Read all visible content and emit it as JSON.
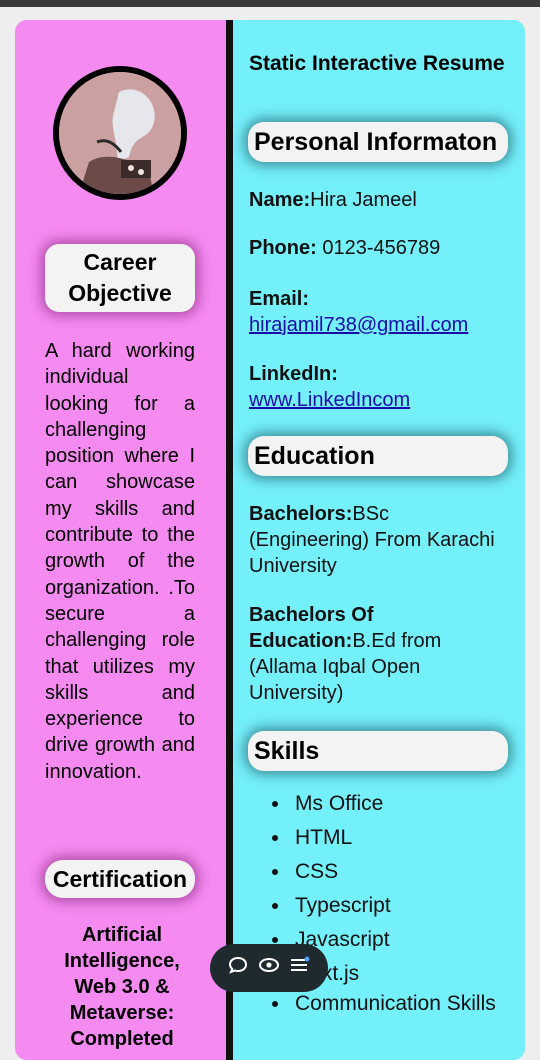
{
  "left": {
    "career_title": "Career Objective",
    "objective": "A hard working individual looking for a challenging position where I can showcase my skills and contribute to the growth of the organization. .To secure a challenging role that utilizes my skills and experience to drive growth and innovation.",
    "cert_title": "Certification",
    "cert_text": "Artificial Intelligence, Web 3.0 & Metaverse: Completed"
  },
  "right": {
    "title": "Static Interactive Resume",
    "personal_header": "Personal Informaton",
    "name_label": "Name:",
    "name_value": "Hira Jameel",
    "phone_label": "Phone:",
    "phone_value": " 0123-456789",
    "email_label": "Email:",
    "email_value": "hirajamil738@gmail.com",
    "linkedin_label": "LinkedIn:",
    "linkedin_value": "www.LinkedIncom",
    "education_header": "Education",
    "edu1_label": "Bachelors:",
    "edu1_value": "BSc (Engineering) From Karachi University",
    "edu2_label": "Bachelors Of Education:",
    "edu2_value": "B.Ed from (Allama Iqbal Open University)",
    "skills_header": "Skills",
    "skills": [
      "Ms Office",
      "HTML",
      "CSS",
      "Typescript",
      "Javascript",
      "Next.js",
      "Communication Skills"
    ]
  },
  "floatbar": {
    "icons": [
      "chat-icon",
      "eye-icon",
      "menu-icon"
    ]
  }
}
